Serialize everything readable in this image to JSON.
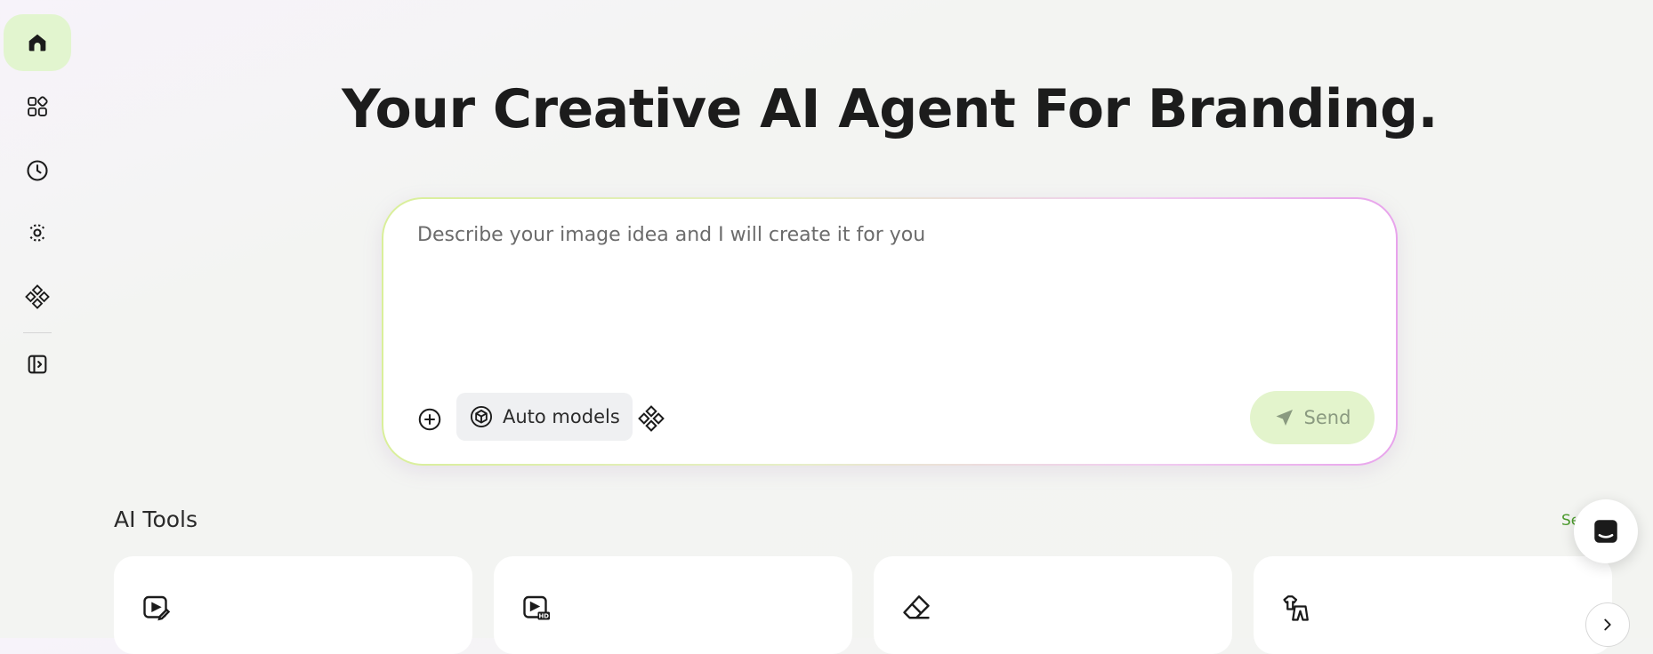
{
  "sidebar": {
    "items": [
      {
        "icon": "home-icon",
        "label": "Home",
        "active": true
      },
      {
        "icon": "apps-grid-icon",
        "label": "Apps"
      },
      {
        "icon": "clock-icon",
        "label": "History"
      },
      {
        "icon": "broadcast-icon",
        "label": "Explore"
      },
      {
        "icon": "diamond-cluster-icon",
        "label": "Models"
      },
      {
        "icon": "expand-panel-icon",
        "label": "Expand sidebar"
      }
    ]
  },
  "hero": {
    "title": "Your Creative AI Agent For Branding."
  },
  "prompt": {
    "placeholder": "Describe your image idea and I will create it for you",
    "value": "",
    "models_label": "Auto models",
    "send_label": "Send"
  },
  "tools": {
    "heading": "AI Tools",
    "see_all_label": "See all",
    "cards": [
      {
        "icon": "video-edit-icon"
      },
      {
        "icon": "video-hd-icon"
      },
      {
        "icon": "eraser-icon"
      },
      {
        "icon": "clothing-icon"
      }
    ]
  },
  "colors": {
    "accent_green": "#e2f5cf",
    "link_green": "#4c9b2e",
    "send_bg": "#e3f4cc",
    "gradient_start": "#d9ef9a",
    "gradient_end": "#e8a3ec"
  }
}
